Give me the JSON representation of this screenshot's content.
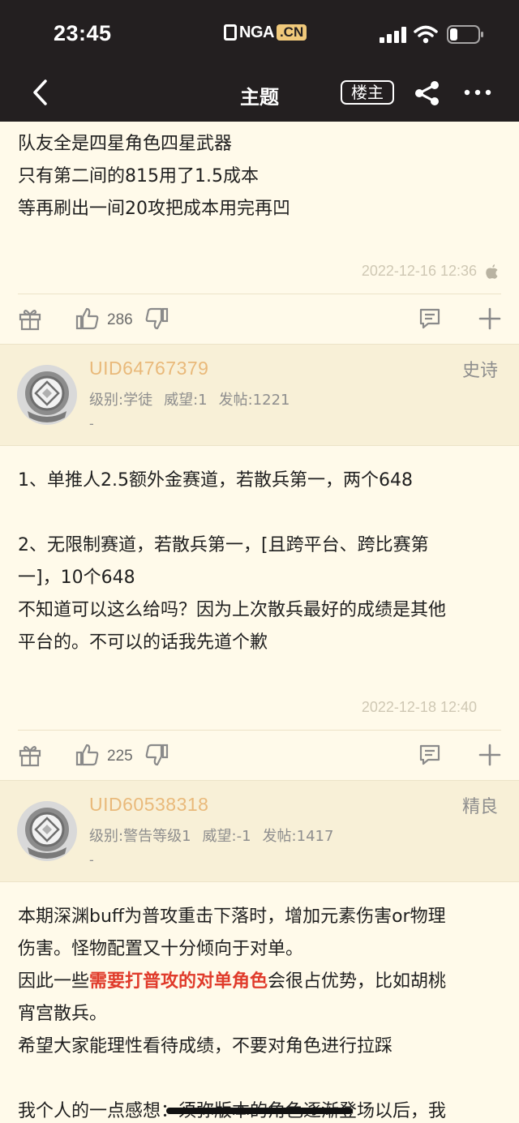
{
  "status_bar": {
    "time": "23:45",
    "logo_main": "NGA",
    "logo_suffix": ".CN"
  },
  "nav": {
    "title": "主题",
    "op_label": "楼主"
  },
  "colors": {
    "header_bg": "#231f20",
    "page_bg": "#fffaea",
    "author_bg": "#f8f0d7",
    "uid_color": "#e9b97a",
    "highlight": "#e03b2b"
  },
  "post1": {
    "lines": [
      "队友全是四星角色四星武器",
      "只有第二间的815用了1.5成本",
      "等再刷出一间20攻把成本用完再凹"
    ],
    "timestamp": "2022-12-16 12:36",
    "likes": "286"
  },
  "reply1": {
    "uid": "UID64767379",
    "level": "级别:学徒",
    "prestige": "威望:1",
    "posts": "发帖:1221",
    "extra": "-",
    "rank": "史诗",
    "lines": [
      "1、单推人2.5额外金赛道，若散兵第一，两个648",
      "",
      "2、无限制赛道，若散兵第一，[且跨平台、跨比赛第",
      "一]，10个648",
      "不知道可以这么给吗？因为上次散兵最好的成绩是其他",
      "平台的。不可以的话我先道个歉"
    ],
    "timestamp": "2022-12-18 12:40",
    "likes": "225"
  },
  "reply2": {
    "uid": "UID60538318",
    "level": "级别:警告等级1",
    "prestige": "威望:-1",
    "posts": "发帖:1417",
    "extra": "-",
    "rank": "精良",
    "line1": "本期深渊buff为普攻重击下落时，增加元素伤害or物理",
    "line2": "伤害。怪物配置又十分倾向于对单。",
    "line3_pre": "因此一些",
    "line3_highlight": "需要打普攻的对单角色",
    "line3_post": "会很占优势，比如胡桃",
    "line4": "宵宫散兵。",
    "line5": "希望大家能理性看待成绩，不要对角色进行拉踩",
    "line7": "我个人的一点感想：须弥版本的角色逐渐登场以后，我"
  },
  "icons": [
    "back-icon",
    "share-icon",
    "more-icon",
    "gift-icon",
    "like-icon",
    "dislike-icon",
    "comment-icon",
    "plus-icon",
    "avatar-helmet",
    "apple-icon"
  ]
}
